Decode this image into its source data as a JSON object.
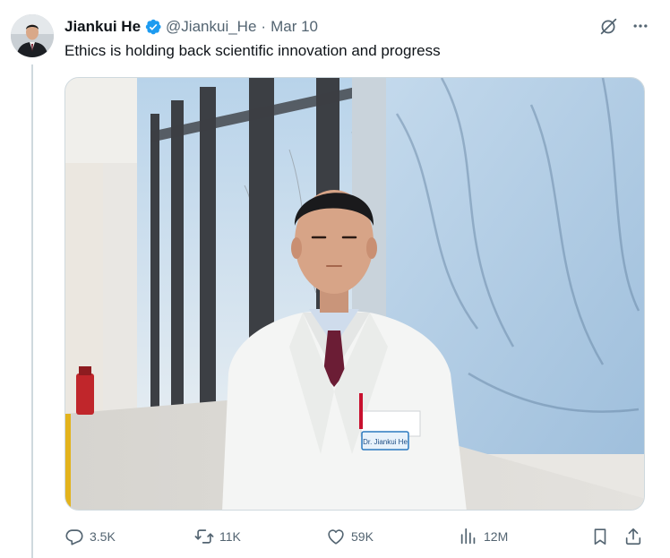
{
  "author": {
    "display_name": "Jiankui He",
    "handle": "@Jiankui_He",
    "separator": "·",
    "date": "Mar 10",
    "verified_icon": "verified-badge-icon",
    "verified_color": "#1d9bf0"
  },
  "tweet": {
    "text": "Ethics is holding back scientific innovation and progress"
  },
  "media": {
    "badge_text": "Dr. Jiankui He"
  },
  "metrics": {
    "replies": "3.5K",
    "retweets": "11K",
    "likes": "59K",
    "views": "12M"
  },
  "icons": {
    "grok": "grok-icon",
    "more": "more-icon",
    "reply": "reply-icon",
    "retweet": "retweet-icon",
    "like": "heart-icon",
    "views": "views-icon",
    "bookmark": "bookmark-icon",
    "share": "share-icon"
  }
}
